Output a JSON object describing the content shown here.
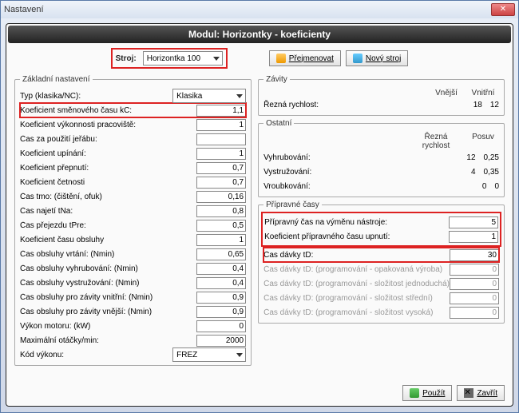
{
  "window_title": "Nastavení",
  "banner": "Modul: Horizontky - koeficienty",
  "stroj_label": "Stroj:",
  "stroj_value": "Horizontka 100",
  "btn_rename": "Přejmenovat",
  "btn_new": "Nový stroj",
  "groups": {
    "zakladni": "Základní nastavení",
    "zavity": "Závity",
    "ostatni": "Ostatní",
    "pripravne": "Přípravné časy"
  },
  "zakl": {
    "typ_lbl": "Typ (klasika/NC):",
    "typ_val": "Klasika",
    "ksc_lbl": "Koeficient směnového času kC:",
    "ksc_val": "1,1",
    "kvp_lbl": "Koeficient výkonnosti pracoviště:",
    "kvp_val": "1",
    "jerab_lbl": "Čas za použití jeřábu:",
    "jerab_val": "",
    "kup_lbl": "Koeficient upínání:",
    "kup_val": "1",
    "kprep_lbl": "Koeficient přepnutí:",
    "kprep_val": "0,7",
    "kcet_lbl": "Koeficient četnosti",
    "kcet_val": "0,7",
    "tmo_lbl": "Čas tmo: (čištění, ofuk)",
    "tmo_val": "0,16",
    "najeti_lbl": "Čas najetí tNa:",
    "najeti_val": "0,8",
    "tpre_lbl": "Čas přejezdu tPre:",
    "tpre_val": "0,5",
    "kobs_lbl": "Koeficient času obsluhy",
    "kobs_val": "1",
    "vrt_lbl": "Čas obsluhy vrtání: (Nmin)",
    "vrt_val": "0,65",
    "vyhr_lbl": "Čas obsluhy vyhrubování: (Nmin)",
    "vyhr_val": "0,4",
    "vystr_lbl": "Čas obsluhy vystružování: (Nmin)",
    "vystr_val": "0,4",
    "zvni_lbl": "Čas obsluhy pro závity vnitřní: (Nmin)",
    "zvni_val": "0,9",
    "zvne_lbl": "Čas obsluhy pro závity vnější: (Nmin)",
    "zvne_val": "0,9",
    "vykon_lbl": "Výkon motoru: (kW)",
    "vykon_val": "0",
    "otacky_lbl": "Maximální otáčky/min:",
    "otacky_val": "2000",
    "kod_lbl": "Kód výkonu:",
    "kod_val": "FREZ"
  },
  "zavity": {
    "vnejsi_hdr": "Vnější",
    "vnitrni_hdr": "Vnitřní",
    "rezna_lbl": "Řezná rychlost:",
    "vnejsi_val": "18",
    "vnitrni_val": "12"
  },
  "ostatni": {
    "rezna_hdr": "Řezná rychlost",
    "posuv_hdr": "Posuv",
    "vyhr_lbl": "Vyhrubování:",
    "vyhr_r": "12",
    "vyhr_p": "0,25",
    "vystr_lbl": "Vystružování:",
    "vystr_r": "4",
    "vystr_p": "0,35",
    "vroub_lbl": "Vroubkování:",
    "vroub_r": "0",
    "vroub_p": "0"
  },
  "priprav": {
    "vymena_lbl": "Přípravný čas na výměnu nástroje:",
    "vymena_val": "5",
    "upnuti_lbl": "Koeficient přípravného času upnutí:",
    "upnuti_val": "1",
    "davky_lbl": "Čas dávky tD:",
    "davky_val": "30",
    "d1_lbl": "Čas dávky tD: (programování - opakovaná výroba)",
    "d1_val": "0",
    "d2_lbl": "Čas dávky tD: (programování - složitost jednoduchá)",
    "d2_val": "0",
    "d3_lbl": "Čas dávky tD: (programování - složitost střední)",
    "d3_val": "0",
    "d4_lbl": "Čas dávky tD: (programování - složitost vysoká)",
    "d4_val": "0"
  },
  "btn_apply": "Použít",
  "btn_close": "Zavřít"
}
